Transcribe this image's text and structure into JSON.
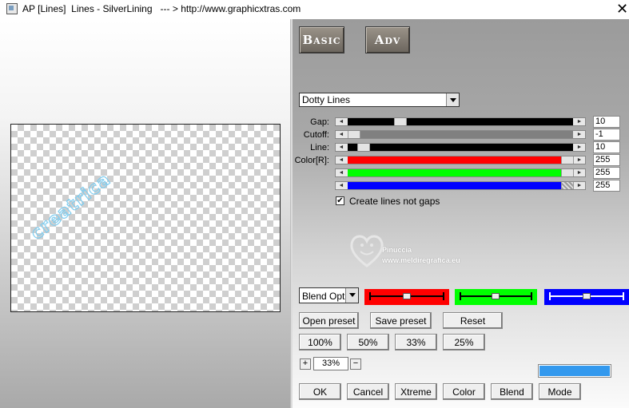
{
  "window": {
    "title": "AP [Lines]  Lines - SilverLining   --- > http://www.graphicxtras.com",
    "close_glyph": "✕"
  },
  "preview": {
    "watermark_text": "creatrica"
  },
  "mode_buttons": {
    "basic": "Basic",
    "adv": "Adv"
  },
  "effect_dropdown": {
    "selected": "Dotty Lines"
  },
  "sliders": [
    {
      "label": "Gap:",
      "value": "10",
      "fill": "#000000"
    },
    {
      "label": "Cutoff:",
      "value": "-1",
      "fill": "#808080"
    },
    {
      "label": "Line:",
      "value": "10",
      "fill": "#000000"
    },
    {
      "label": "Color[R]:",
      "value": "255",
      "fill": "#ff0000"
    },
    {
      "label": "",
      "value": "255",
      "fill": "#00ff00"
    },
    {
      "label": "",
      "value": "255",
      "fill": "#0000ff"
    }
  ],
  "checkbox": {
    "label": "Create lines not gaps",
    "checked": true,
    "glyph": "✔"
  },
  "logo": {
    "line1": "Pinuccia",
    "line2": "www.meldiregrafica.eu",
    "icon": "heart-smiley-icon"
  },
  "blend": {
    "selected": "Blend Options"
  },
  "channel_colors": {
    "red": "#ff0000",
    "green": "#00ff00",
    "blue": "#0000ff"
  },
  "buttons": {
    "open_preset": "Open preset",
    "save_preset": "Save preset",
    "reset": "Reset",
    "zoom_100": "100%",
    "zoom_50": "50%",
    "zoom_33": "33%",
    "zoom_25": "25%",
    "plus": "+",
    "minus": "−",
    "ok": "OK",
    "cancel": "Cancel",
    "xtreme": "Xtreme",
    "color": "Color",
    "blend": "Blend",
    "mode": "Mode"
  },
  "zoom_field": {
    "value": "33%"
  },
  "swatch_color": "#3399ee"
}
